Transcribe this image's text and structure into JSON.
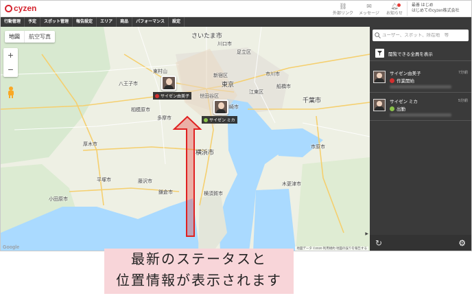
{
  "app": {
    "logo": "cyzen"
  },
  "header": {
    "links": [
      {
        "label": "外部リンク",
        "icon": "link-icon"
      },
      {
        "label": "メッセージ",
        "icon": "message-icon"
      },
      {
        "label": "お知らせ",
        "icon": "bell-icon"
      }
    ],
    "user": {
      "line1": "最善 はじめ",
      "line2": "はじめてのcyzen株式会社"
    }
  },
  "nav": {
    "items": [
      "行動管理",
      "予定",
      "スポット管理",
      "報告設定",
      "エリア",
      "商品",
      "パフォーマンス",
      "設定"
    ]
  },
  "map": {
    "type_buttons": [
      "地図",
      "航空写真"
    ],
    "zoom_in": "+",
    "zoom_out": "−",
    "attribution": "地図データ ©2020   利用規約   地図の誤りを報告する",
    "google_logo": "Google",
    "places": {
      "saitama": "さいたま市",
      "kawaguchi": "川口市",
      "adachi": "足立区",
      "shinjuku": "新宿区",
      "tokyo": "東京",
      "koto": "江東区",
      "hachioji": "八王子市",
      "setagaya": "世田谷区",
      "chiba": "千葉市",
      "sagamihara": "相模原市",
      "yokohama": "横浜市",
      "yokosuka": "横須賀市",
      "tama": "多摩市",
      "higashimurayama": "東村山",
      "ichikawa": "市川市",
      "funabashi": "船橋市",
      "kisarazu": "木更津市",
      "kamakura": "鎌倉市",
      "atsugi": "厚木市",
      "fujisawa": "藤沢市",
      "hiratsuka": "平塚市",
      "odawara": "小田原市",
      "ichihara": "市原市",
      "kawasaki": "川崎市"
    },
    "markers": [
      {
        "label": "サイゼン由美子",
        "status_color": "#d32f2f"
      },
      {
        "label": "サイゼン ミカ",
        "status_color": "#8bc34a"
      }
    ]
  },
  "sidebar": {
    "search_placeholder": "ユーザー、スポット、所在地　等",
    "filter_label": "閲覧できる全員を表示",
    "members": [
      {
        "name": "サイゼン由美子",
        "time": "7分前",
        "status": "作業開始",
        "status_color": "#d32f2f"
      },
      {
        "name": "サイゼン ミカ",
        "time": "5分前",
        "status": "出勤",
        "status_color": "#8bc34a"
      }
    ]
  },
  "caption": {
    "line1": "最新のステータスと",
    "line2": "位置情報が表示されます"
  }
}
